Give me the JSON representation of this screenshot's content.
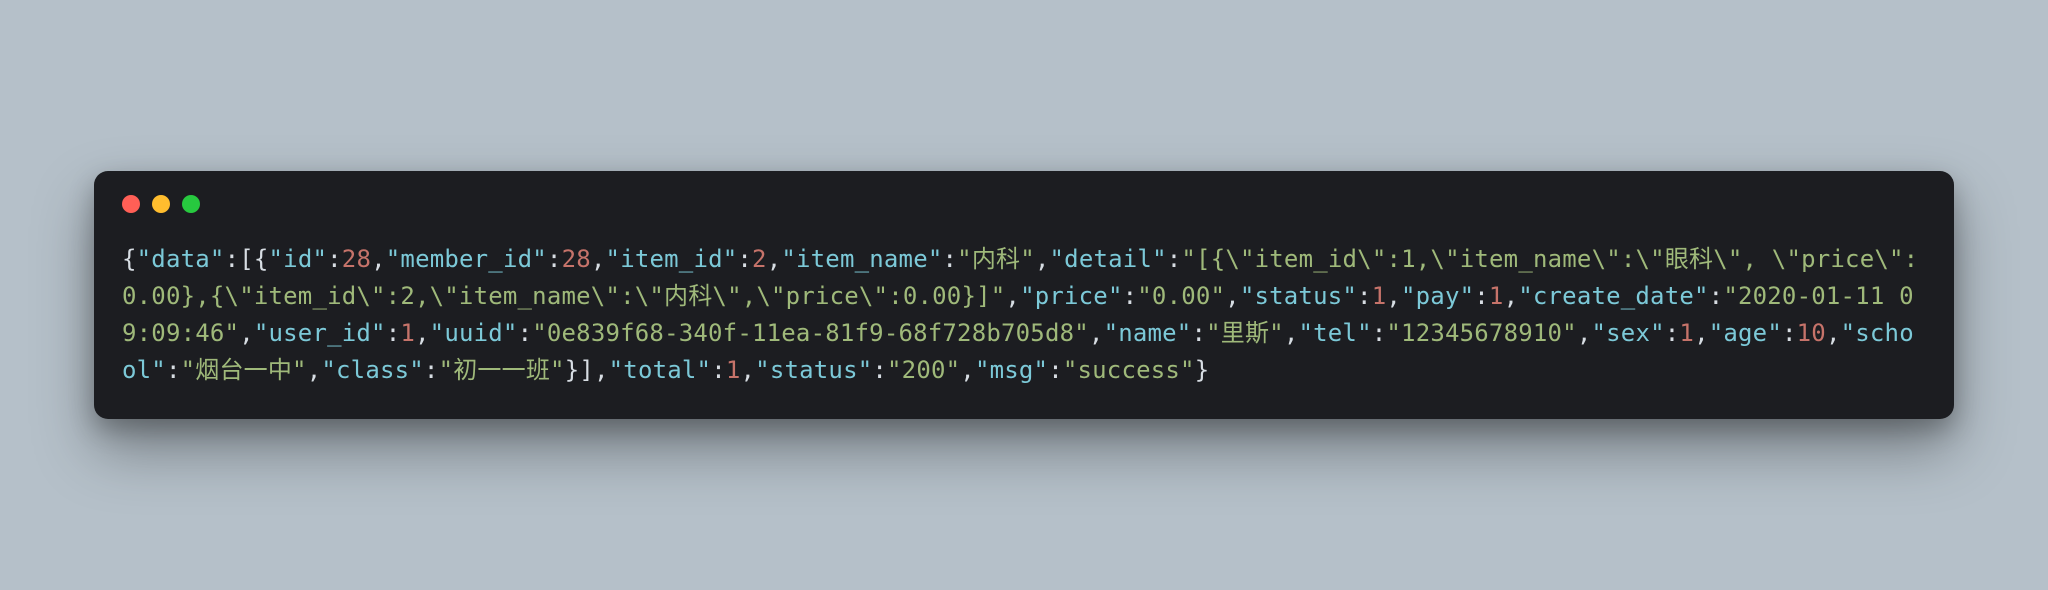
{
  "colors": {
    "bg_page": "#b5c0c9",
    "bg_terminal": "#1c1d21",
    "dot_red": "#ff5f56",
    "dot_yellow": "#ffbd2e",
    "dot_green": "#27c93f",
    "punctuation": "#d7dde3",
    "key": "#7cc9d8",
    "string": "#9fb97a",
    "number": "#c6736a"
  },
  "code_tokens": [
    {
      "t": "punc",
      "v": "{"
    },
    {
      "t": "key",
      "v": "\"data\""
    },
    {
      "t": "punc",
      "v": ":["
    },
    {
      "t": "punc",
      "v": "{"
    },
    {
      "t": "key",
      "v": "\"id\""
    },
    {
      "t": "punc",
      "v": ":"
    },
    {
      "t": "num",
      "v": "28"
    },
    {
      "t": "punc",
      "v": ","
    },
    {
      "t": "key",
      "v": "\"member_id\""
    },
    {
      "t": "punc",
      "v": ":"
    },
    {
      "t": "num",
      "v": "28"
    },
    {
      "t": "punc",
      "v": ","
    },
    {
      "t": "key",
      "v": "\"item_id\""
    },
    {
      "t": "punc",
      "v": ":"
    },
    {
      "t": "num",
      "v": "2"
    },
    {
      "t": "punc",
      "v": ","
    },
    {
      "t": "key",
      "v": "\"item_name\""
    },
    {
      "t": "punc",
      "v": ":"
    },
    {
      "t": "str",
      "v": "\"内科\""
    },
    {
      "t": "punc",
      "v": ","
    },
    {
      "t": "key",
      "v": "\"detail\""
    },
    {
      "t": "punc",
      "v": ":"
    },
    {
      "t": "str",
      "v": "\"[{\\\"item_id\\\":1,\\\"item_name\\\":\\\"眼科\\\", \\\"price\\\":0.00},{\\\"item_id\\\":2,\\\"item_name\\\":\\\"内科\\\",\\\"price\\\":0.00}]\""
    },
    {
      "t": "punc",
      "v": ","
    },
    {
      "t": "key",
      "v": "\"price\""
    },
    {
      "t": "punc",
      "v": ":"
    },
    {
      "t": "str",
      "v": "\"0.00\""
    },
    {
      "t": "punc",
      "v": ","
    },
    {
      "t": "key",
      "v": "\"status\""
    },
    {
      "t": "punc",
      "v": ":"
    },
    {
      "t": "num",
      "v": "1"
    },
    {
      "t": "punc",
      "v": ","
    },
    {
      "t": "key",
      "v": "\"pay\""
    },
    {
      "t": "punc",
      "v": ":"
    },
    {
      "t": "num",
      "v": "1"
    },
    {
      "t": "punc",
      "v": ","
    },
    {
      "t": "key",
      "v": "\"create_date\""
    },
    {
      "t": "punc",
      "v": ":"
    },
    {
      "t": "str",
      "v": "\"2020-01-11 09:09:46\""
    },
    {
      "t": "punc",
      "v": ","
    },
    {
      "t": "key",
      "v": "\"user_id\""
    },
    {
      "t": "punc",
      "v": ":"
    },
    {
      "t": "num",
      "v": "1"
    },
    {
      "t": "punc",
      "v": ","
    },
    {
      "t": "key",
      "v": "\"uuid\""
    },
    {
      "t": "punc",
      "v": ":"
    },
    {
      "t": "str",
      "v": "\"0e839f68-340f-11ea-81f9-68f728b705d8\""
    },
    {
      "t": "punc",
      "v": ","
    },
    {
      "t": "key",
      "v": "\"name\""
    },
    {
      "t": "punc",
      "v": ":"
    },
    {
      "t": "str",
      "v": "\"里斯\""
    },
    {
      "t": "punc",
      "v": ","
    },
    {
      "t": "key",
      "v": "\"tel\""
    },
    {
      "t": "punc",
      "v": ":"
    },
    {
      "t": "str",
      "v": "\"12345678910\""
    },
    {
      "t": "punc",
      "v": ","
    },
    {
      "t": "key",
      "v": "\"sex\""
    },
    {
      "t": "punc",
      "v": ":"
    },
    {
      "t": "num",
      "v": "1"
    },
    {
      "t": "punc",
      "v": ","
    },
    {
      "t": "key",
      "v": "\"age\""
    },
    {
      "t": "punc",
      "v": ":"
    },
    {
      "t": "num",
      "v": "10"
    },
    {
      "t": "punc",
      "v": ","
    },
    {
      "t": "key",
      "v": "\"school\""
    },
    {
      "t": "punc",
      "v": ":"
    },
    {
      "t": "str",
      "v": "\"烟台一中\""
    },
    {
      "t": "punc",
      "v": ","
    },
    {
      "t": "key",
      "v": "\"class\""
    },
    {
      "t": "punc",
      "v": ":"
    },
    {
      "t": "str",
      "v": "\"初一一班\""
    },
    {
      "t": "punc",
      "v": "}"
    },
    {
      "t": "punc",
      "v": "]"
    },
    {
      "t": "punc",
      "v": ","
    },
    {
      "t": "key",
      "v": "\"total\""
    },
    {
      "t": "punc",
      "v": ":"
    },
    {
      "t": "num",
      "v": "1"
    },
    {
      "t": "punc",
      "v": ","
    },
    {
      "t": "key",
      "v": "\"status\""
    },
    {
      "t": "punc",
      "v": ":"
    },
    {
      "t": "str",
      "v": "\"200\""
    },
    {
      "t": "punc",
      "v": ","
    },
    {
      "t": "key",
      "v": "\"msg\""
    },
    {
      "t": "punc",
      "v": ":"
    },
    {
      "t": "str",
      "v": "\"success\""
    },
    {
      "t": "punc",
      "v": "}"
    }
  ]
}
